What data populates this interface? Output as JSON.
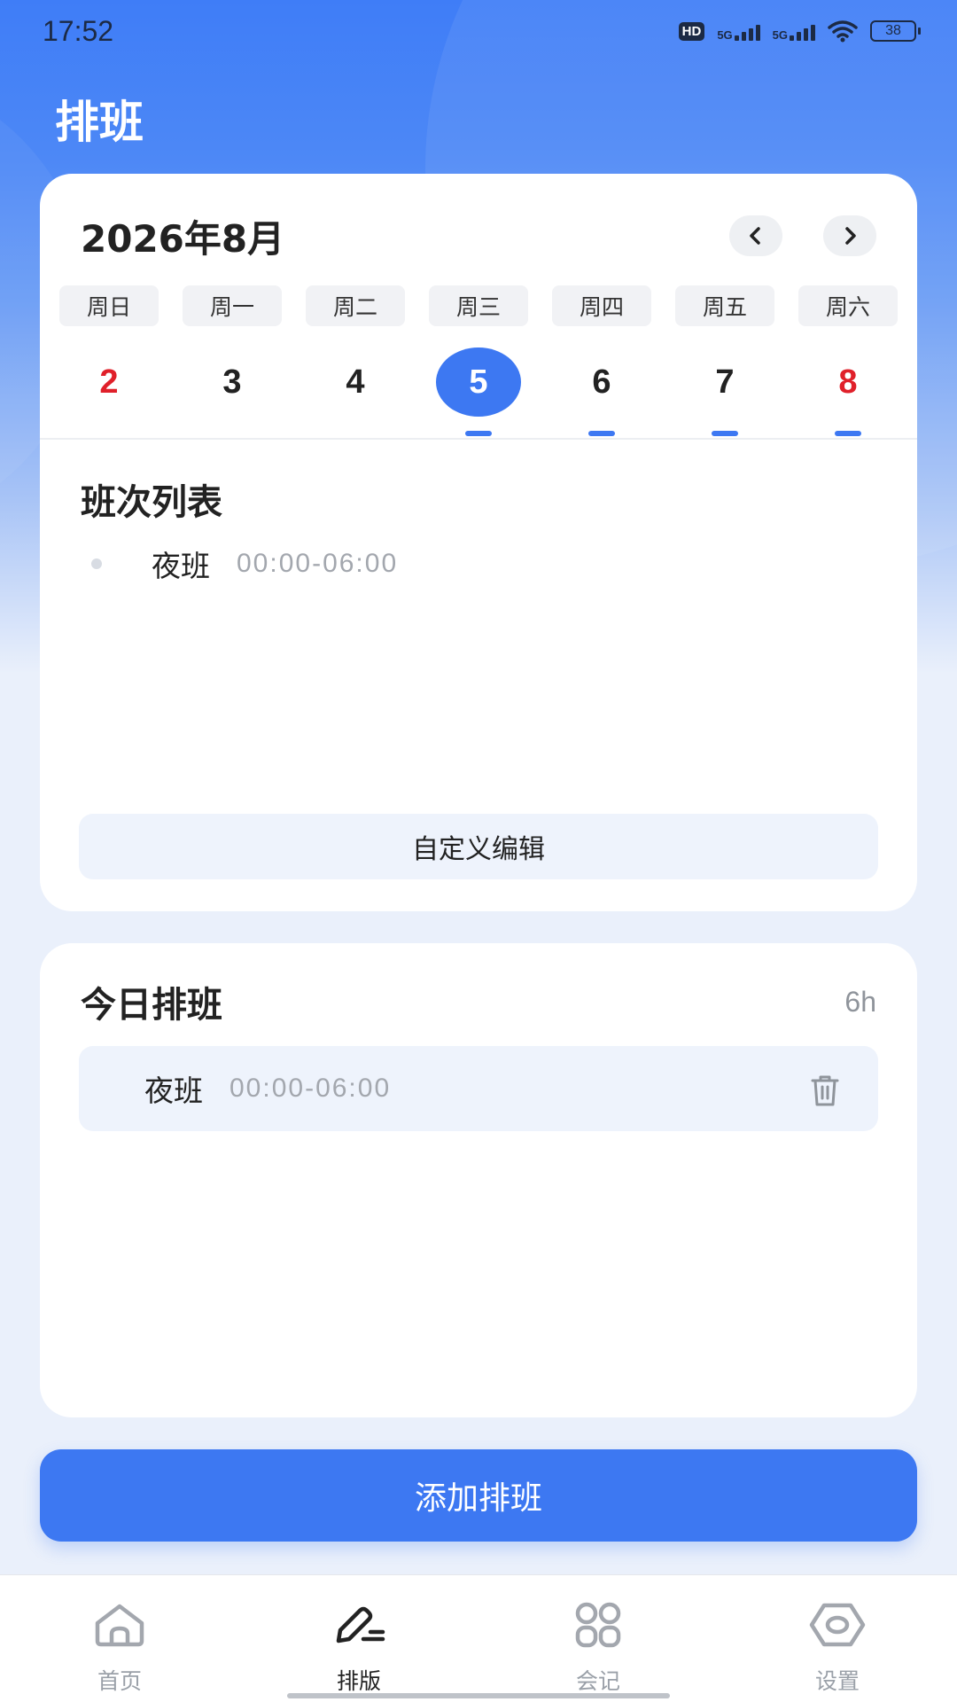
{
  "status_bar": {
    "time": "17:52",
    "hd_label": "HD",
    "network_1": "5G",
    "network_2": "5G",
    "battery": "38"
  },
  "header": {
    "title": "排班"
  },
  "calendar": {
    "month_title": "2026年8月",
    "prev_icon": "chevron-left-icon",
    "next_icon": "chevron-right-icon",
    "weekdays": [
      "周日",
      "周一",
      "周二",
      "周三",
      "周四",
      "周五",
      "周六"
    ],
    "dates": [
      {
        "day": "2",
        "weekend": true,
        "selected": false,
        "has_shift": false
      },
      {
        "day": "3",
        "weekend": false,
        "selected": false,
        "has_shift": false
      },
      {
        "day": "4",
        "weekend": false,
        "selected": false,
        "has_shift": false
      },
      {
        "day": "5",
        "weekend": false,
        "selected": true,
        "has_shift": true
      },
      {
        "day": "6",
        "weekend": false,
        "selected": false,
        "has_shift": true
      },
      {
        "day": "7",
        "weekend": false,
        "selected": false,
        "has_shift": true
      },
      {
        "day": "8",
        "weekend": true,
        "selected": false,
        "has_shift": true
      }
    ],
    "accent_color": "#3D78F2",
    "weekend_color": "#E0202A"
  },
  "shift_list": {
    "title": "班次列表",
    "items": [
      {
        "name": "夜班",
        "time": "00:00-06:00"
      }
    ],
    "custom_edit_label": "自定义编辑"
  },
  "today": {
    "title": "今日排班",
    "total_hours": "6h",
    "items": [
      {
        "name": "夜班",
        "time": "00:00-06:00",
        "delete_icon": "trash-icon"
      }
    ]
  },
  "add_button_label": "添加排班",
  "tabbar": {
    "items": [
      {
        "label": "首页",
        "icon": "home-icon",
        "active": false
      },
      {
        "label": "排版",
        "icon": "edit-pen-icon",
        "active": true
      },
      {
        "label": "会记",
        "icon": "grid-icon",
        "active": false
      },
      {
        "label": "设置",
        "icon": "settings-icon",
        "active": false
      }
    ]
  }
}
